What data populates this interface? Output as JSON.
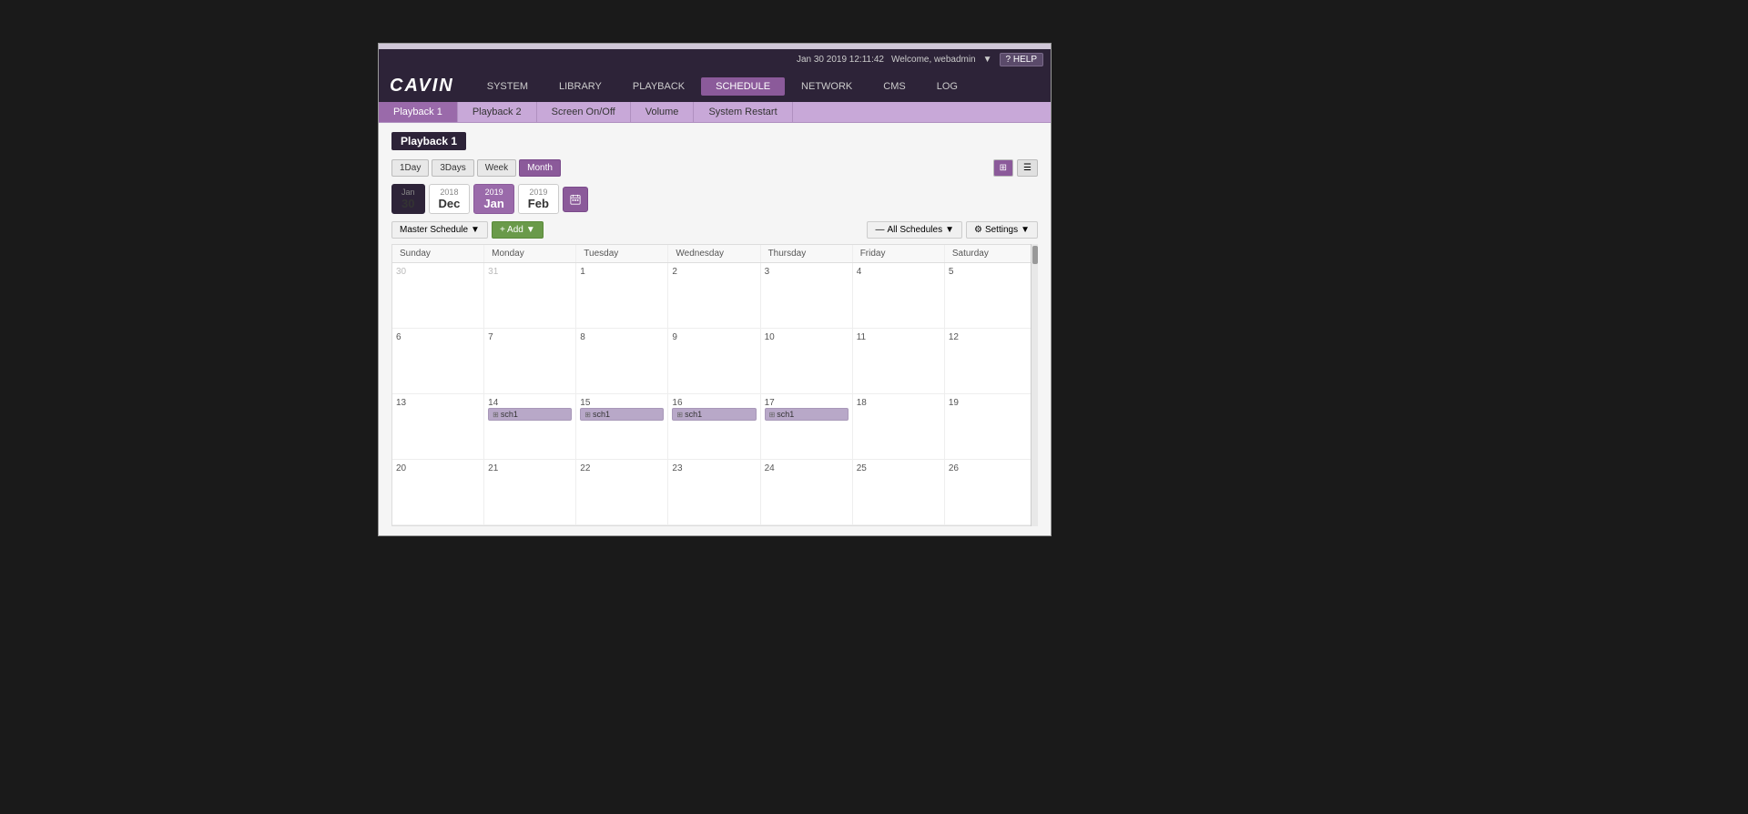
{
  "topBar": {
    "datetime": "Jan 30 2019 12:11:42",
    "welcome": "Welcome, webadmin",
    "helpLabel": "? HELP"
  },
  "logo": "CAVIN",
  "mainNav": [
    {
      "id": "system",
      "label": "SYSTEM",
      "active": false
    },
    {
      "id": "library",
      "label": "LIBRARY",
      "active": false
    },
    {
      "id": "playback",
      "label": "PLAYBACK",
      "active": false
    },
    {
      "id": "schedule",
      "label": "SCHEDULE",
      "active": true
    },
    {
      "id": "network",
      "label": "NETWORK",
      "active": false
    },
    {
      "id": "cms",
      "label": "CMS",
      "active": false
    },
    {
      "id": "log",
      "label": "LOG",
      "active": false
    }
  ],
  "subNav": [
    {
      "id": "playback1",
      "label": "Playback 1",
      "active": true
    },
    {
      "id": "playback2",
      "label": "Playback 2",
      "active": false
    },
    {
      "id": "screenOnOff",
      "label": "Screen On/Off",
      "active": false
    },
    {
      "id": "volume",
      "label": "Volume",
      "active": false
    },
    {
      "id": "systemRestart",
      "label": "System Restart",
      "active": false
    }
  ],
  "pageTitle": "Playback 1",
  "viewButtons": [
    {
      "id": "1day",
      "label": "1Day",
      "active": false
    },
    {
      "id": "3days",
      "label": "3Days",
      "active": false
    },
    {
      "id": "week",
      "label": "Week",
      "active": false
    },
    {
      "id": "month",
      "label": "Month",
      "active": true
    }
  ],
  "dateNav": [
    {
      "id": "jan30",
      "year": "Jan",
      "value": "30",
      "type": "today"
    },
    {
      "id": "dec2018",
      "year": "2018",
      "value": "Dec",
      "type": "normal"
    },
    {
      "id": "jan2019",
      "year": "2019",
      "value": "Jan",
      "type": "selected"
    },
    {
      "id": "feb2019",
      "year": "2019",
      "value": "Feb",
      "type": "normal"
    }
  ],
  "toolbar": {
    "masterSchedule": "Master Schedule",
    "addLabel": "+ Add",
    "allSchedules": "All Schedules",
    "settingsLabel": "⚙ Settings"
  },
  "calendar": {
    "headers": [
      "Sunday",
      "Monday",
      "Tuesday",
      "Wednesday",
      "Thursday",
      "Friday",
      "Saturday"
    ],
    "weeks": [
      [
        {
          "day": 30,
          "type": "prev"
        },
        {
          "day": 31,
          "type": "prev"
        },
        {
          "day": 1,
          "type": "current",
          "events": []
        },
        {
          "day": 2,
          "type": "current",
          "events": []
        },
        {
          "day": 3,
          "type": "current",
          "events": []
        },
        {
          "day": 4,
          "type": "current",
          "events": []
        },
        {
          "day": 5,
          "type": "current",
          "events": []
        }
      ],
      [
        {
          "day": 6,
          "type": "current",
          "events": []
        },
        {
          "day": 7,
          "type": "current",
          "events": []
        },
        {
          "day": 8,
          "type": "current",
          "events": []
        },
        {
          "day": 9,
          "type": "current",
          "events": []
        },
        {
          "day": 10,
          "type": "current",
          "events": []
        },
        {
          "day": 11,
          "type": "current",
          "events": []
        },
        {
          "day": 12,
          "type": "current",
          "events": []
        }
      ],
      [
        {
          "day": 13,
          "type": "current",
          "events": []
        },
        {
          "day": 14,
          "type": "current",
          "events": [
            {
              "label": "sch1"
            }
          ]
        },
        {
          "day": 15,
          "type": "current",
          "events": [
            {
              "label": "sch1"
            }
          ]
        },
        {
          "day": 16,
          "type": "current",
          "events": [
            {
              "label": "sch1"
            }
          ]
        },
        {
          "day": 17,
          "type": "current",
          "events": [
            {
              "label": "sch1"
            }
          ]
        },
        {
          "day": 18,
          "type": "current",
          "events": []
        },
        {
          "day": 19,
          "type": "current",
          "events": []
        }
      ],
      [
        {
          "day": 20,
          "type": "current",
          "events": []
        },
        {
          "day": 21,
          "type": "current",
          "events": []
        },
        {
          "day": 22,
          "type": "current",
          "events": []
        },
        {
          "day": 23,
          "type": "current",
          "events": []
        },
        {
          "day": 24,
          "type": "current",
          "events": []
        },
        {
          "day": 25,
          "type": "current",
          "events": []
        },
        {
          "day": 26,
          "type": "current",
          "events": []
        }
      ]
    ]
  }
}
